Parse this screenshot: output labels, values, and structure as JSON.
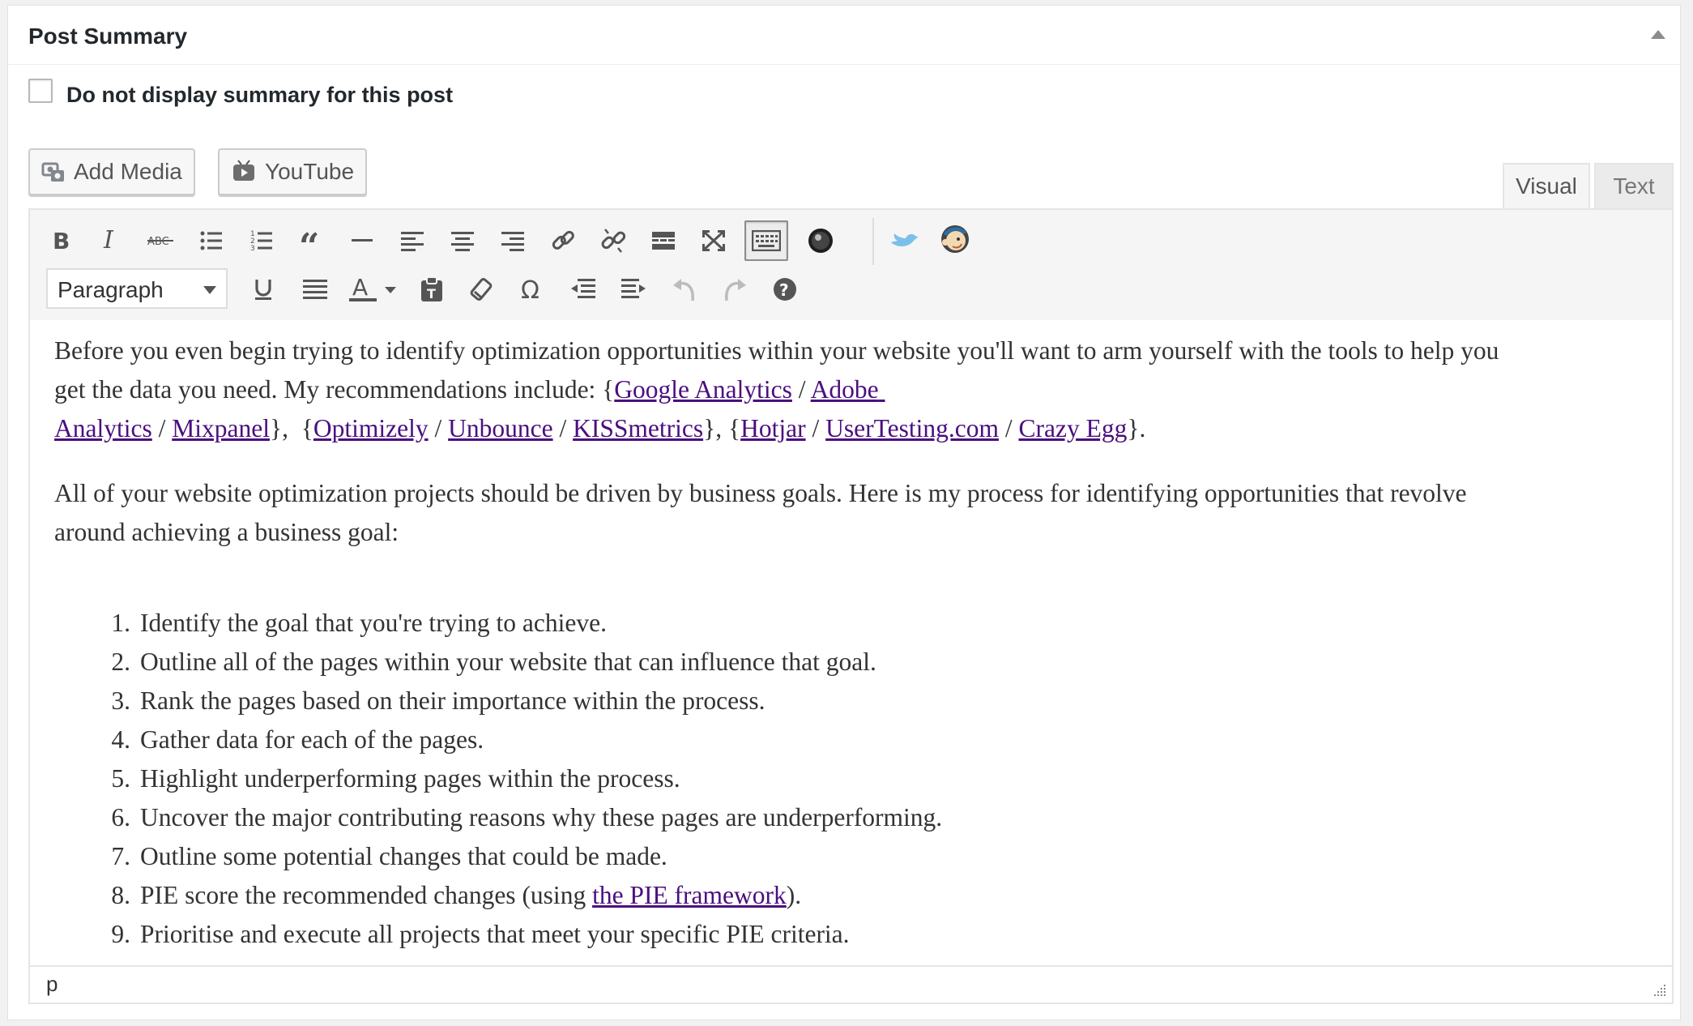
{
  "panel": {
    "title": "Post Summary"
  },
  "option": {
    "label": "Do not display summary for this post",
    "checked": false
  },
  "media_buttons": {
    "add_media": "Add Media",
    "youtube": "YouTube"
  },
  "tabs": {
    "visual": "Visual",
    "text": "Text",
    "active": "Visual"
  },
  "toolbar": {
    "row1": [
      "bold-icon",
      "italic-icon",
      "strikethrough-icon",
      "bullet-list-icon",
      "numbered-list-icon",
      "blockquote-icon",
      "horizontal-line-icon",
      "align-left-icon",
      "align-center-icon",
      "align-right-icon",
      "insert-link-icon",
      "remove-link-icon",
      "read-more-icon",
      "fullscreen-icon",
      "toolbar-toggle-icon",
      "record-icon",
      "twitter-icon",
      "mailchimp-icon"
    ],
    "row2": [
      "underline-icon",
      "justify-icon",
      "text-color-icon",
      "paste-text-icon",
      "clear-formatting-icon",
      "special-character-icon",
      "outdent-icon",
      "indent-icon",
      "undo-icon",
      "redo-icon",
      "help-icon"
    ],
    "format_select": "Paragraph"
  },
  "content": {
    "p1_line1": "Before you even begin trying to identify optimization opportunities within your website you'll want to arm yourself with the tools to help you",
    "p1_line2_prefix": "get the data you need. My recommendations include: {",
    "links": {
      "google_analytics": "Google Analytics",
      "adobe_analytics_1": "Adobe",
      "adobe_analytics_2": "Analytics",
      "mixpanel": "Mixpanel",
      "optimizely": "Optimizely",
      "unbounce": "Unbounce",
      "kissmetrics": "KISSmetrics",
      "hotjar": "Hotjar",
      "usertesting": "UserTesting.com",
      "crazy_egg": "Crazy Egg",
      "pie_framework": "the PIE framework"
    },
    "p2_line1": "All of your website optimization projects should be driven by business goals. Here is my process for identifying opportunities that revolve",
    "p2_line2": "around achieving a business goal:",
    "steps": [
      "Identify the goal that you're trying to achieve.",
      "Outline all of the pages within your website that can influence that goal.",
      "Rank the pages based on their importance within the process.",
      "Gather data for each of the pages.",
      "Highlight underperforming pages within the process.",
      "Uncover the major contributing reasons why these pages are underperforming.",
      "Outline some potential changes that could be made.",
      "PIE score the recommended changes (using ",
      "Prioritise and execute all projects that meet your specific PIE criteria."
    ],
    "step8_suffix": ")."
  },
  "statusbar": {
    "path": "p"
  }
}
